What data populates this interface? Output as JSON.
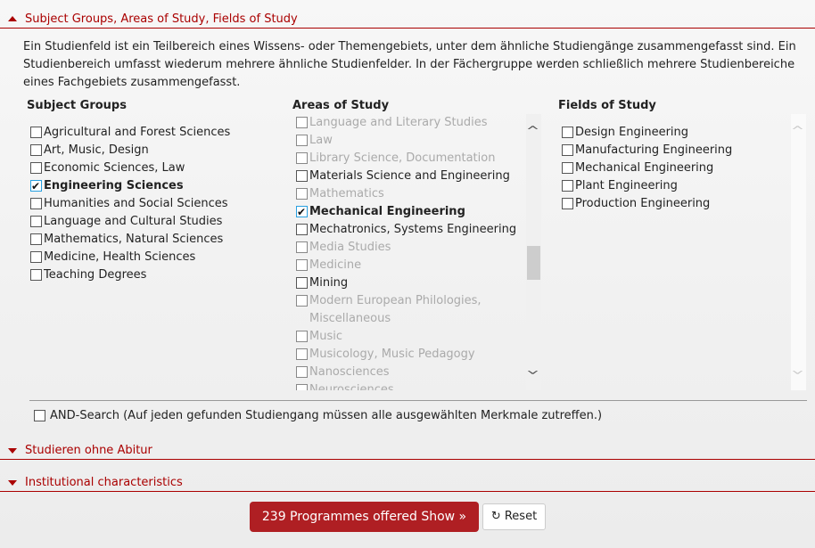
{
  "sections": {
    "subject": "Subject Groups, Areas of Study, Fields of Study",
    "abitur": "Studieren ohne Abitur",
    "institutional": "Institutional characteristics"
  },
  "description": "Ein Studienfeld ist ein Teilbereich eines Wissens- oder Themengebiets, unter dem ähnliche Studiengänge zusammengefasst sind. Ein Studienbereich umfasst wiederum mehrere ähnliche Studienfelder. In der Fächergruppe werden schließlich mehrere Studienbereiche eines Fachgebiets zusammengefasst.",
  "subject_groups": {
    "title": "Subject Groups",
    "items": [
      {
        "label": "Agricultural and Forest Sciences",
        "checked": false
      },
      {
        "label": "Art, Music, Design",
        "checked": false
      },
      {
        "label": "Economic Sciences, Law",
        "checked": false
      },
      {
        "label": "Engineering Sciences",
        "checked": true
      },
      {
        "label": "Humanities and Social Sciences",
        "checked": false
      },
      {
        "label": "Language and Cultural Studies",
        "checked": false
      },
      {
        "label": "Mathematics, Natural Sciences",
        "checked": false
      },
      {
        "label": "Medicine, Health Sciences",
        "checked": false
      },
      {
        "label": "Teaching Degrees",
        "checked": false
      }
    ]
  },
  "areas_of_study": {
    "title": "Areas of Study",
    "items": [
      {
        "label": "Language and Literary Studies",
        "checked": false,
        "disabled": true
      },
      {
        "label": "Law",
        "checked": false,
        "disabled": true
      },
      {
        "label": "Library Science, Documentation",
        "checked": false,
        "disabled": true
      },
      {
        "label": "Materials Science and Engineering",
        "checked": false,
        "disabled": false
      },
      {
        "label": "Mathematics",
        "checked": false,
        "disabled": true
      },
      {
        "label": "Mechanical Engineering",
        "checked": true,
        "disabled": false
      },
      {
        "label": "Mechatronics, Systems Engineering",
        "checked": false,
        "disabled": false
      },
      {
        "label": "Media Studies",
        "checked": false,
        "disabled": true
      },
      {
        "label": "Medicine",
        "checked": false,
        "disabled": true
      },
      {
        "label": "Mining",
        "checked": false,
        "disabled": false
      },
      {
        "label": "Modern European Philologies, Miscellaneous",
        "checked": false,
        "disabled": true
      },
      {
        "label": "Music",
        "checked": false,
        "disabled": true
      },
      {
        "label": "Musicology, Music Pedagogy",
        "checked": false,
        "disabled": true
      },
      {
        "label": "Nanosciences",
        "checked": false,
        "disabled": true
      },
      {
        "label": "Neurosciences",
        "checked": false,
        "disabled": true
      }
    ]
  },
  "fields_of_study": {
    "title": "Fields of Study",
    "items": [
      {
        "label": "Design Engineering",
        "checked": false
      },
      {
        "label": "Manufacturing Engineering",
        "checked": false
      },
      {
        "label": "Mechanical Engineering",
        "checked": false
      },
      {
        "label": "Plant Engineering",
        "checked": false
      },
      {
        "label": "Production Engineering",
        "checked": false
      }
    ]
  },
  "and_search": {
    "label": "AND-Search (Auf jeden gefunden Studiengang müssen alle ausgewählten Merkmale zutreffen.)",
    "checked": false
  },
  "buttons": {
    "show": "239 Programmes offered Show »",
    "reset": "Reset"
  },
  "colors": {
    "accent": "#af1f23",
    "header": "#aa0000"
  }
}
